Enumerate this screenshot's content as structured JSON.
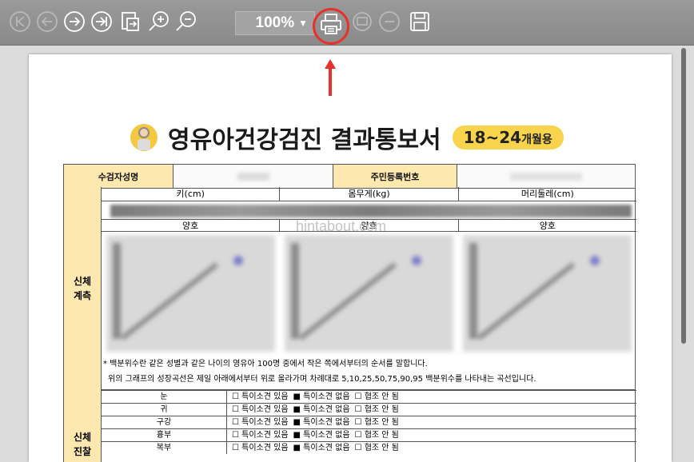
{
  "toolbar": {
    "icons": [
      "first-page-icon",
      "previous-page-icon",
      "next-page-icon",
      "last-page-icon",
      "go-to-page-icon",
      "zoom-in-icon",
      "zoom-out-icon",
      "print-icon",
      "email-icon",
      "minus-circle-icon",
      "save-icon"
    ],
    "zoom_value": "100%",
    "zoom_arrow": "▼"
  },
  "watermark": "hintabout.com",
  "document": {
    "title": "영유아건강검진 결과통보서",
    "age_main": "18~24",
    "age_suffix": "개월용",
    "header": {
      "name_label": "수검자성명",
      "id_label": "주민등록번호"
    },
    "body_measure": {
      "section_label": "신체\n계측",
      "columns": [
        "키(cm)",
        "몸무게(kg)",
        "머리둘레(cm)"
      ],
      "status": [
        "양호",
        "양호",
        "양호"
      ],
      "note_line1": "* 백분위수란 같은 성별과 같은 나이의 영유아 100명 중에서 작은 쪽에서부터의 순서를 말합니다.",
      "note_line2": "위의 그래프의 성장곡선은 제일 아래에서부터 위로 올라가며 차례대로 5,10,25,50,75,90,95 백분위수를 나타내는 곡선입니다."
    },
    "physical_exam": {
      "section_label": "신체\n진찰",
      "option_finding": "☐ 특이소견 있음",
      "option_none": "■ 특이소견 없음",
      "option_uncoop": "☐ 협조 안 됨",
      "items": [
        "눈",
        "귀",
        "구강",
        "흉부",
        "복부"
      ]
    }
  },
  "colors": {
    "toolbar_bg": "#8f8f8f",
    "highlight": "#e8312a",
    "label_bg": "#fde9b0",
    "badge": "#f8d44c"
  }
}
